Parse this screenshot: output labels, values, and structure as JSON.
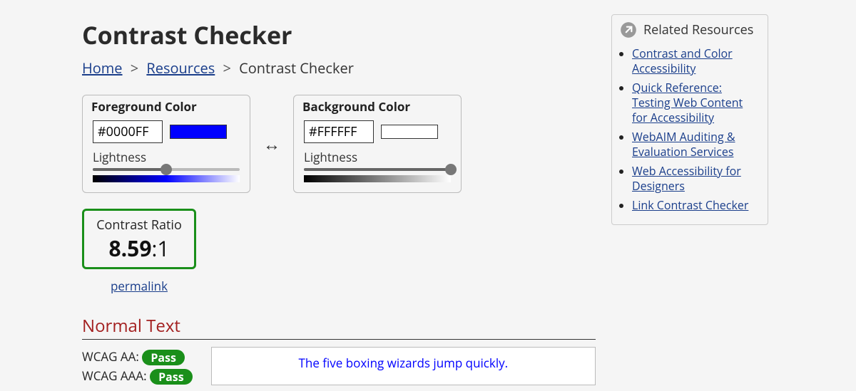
{
  "page_title": "Contrast Checker",
  "breadcrumb": {
    "home": "Home",
    "resources": "Resources",
    "current": "Contrast Checker"
  },
  "foreground": {
    "title": "Foreground Color",
    "hex": "#0000FF",
    "lightness_label": "Lightness",
    "lightness_percent": 50
  },
  "background": {
    "title": "Background Color",
    "hex": "#FFFFFF",
    "lightness_label": "Lightness",
    "lightness_percent": 100
  },
  "swap_symbol": "↔",
  "ratio": {
    "label": "Contrast Ratio",
    "value": "8.59",
    "suffix": ":1",
    "permalink": "permalink"
  },
  "normal_text": {
    "heading": "Normal Text",
    "aa_label": "WCAG AA:",
    "aa_result": "Pass",
    "aaa_label": "WCAG AAA:",
    "aaa_result": "Pass",
    "sample": "The five boxing wizards jump quickly."
  },
  "related": {
    "title": "Related Resources",
    "items": [
      "Contrast and Color Accessibility",
      "Quick Reference: Testing Web Content for Accessibility",
      "WebAIM Auditing & Evaluation Services",
      "Web Accessibility for Designers",
      "Link Contrast Checker"
    ]
  }
}
